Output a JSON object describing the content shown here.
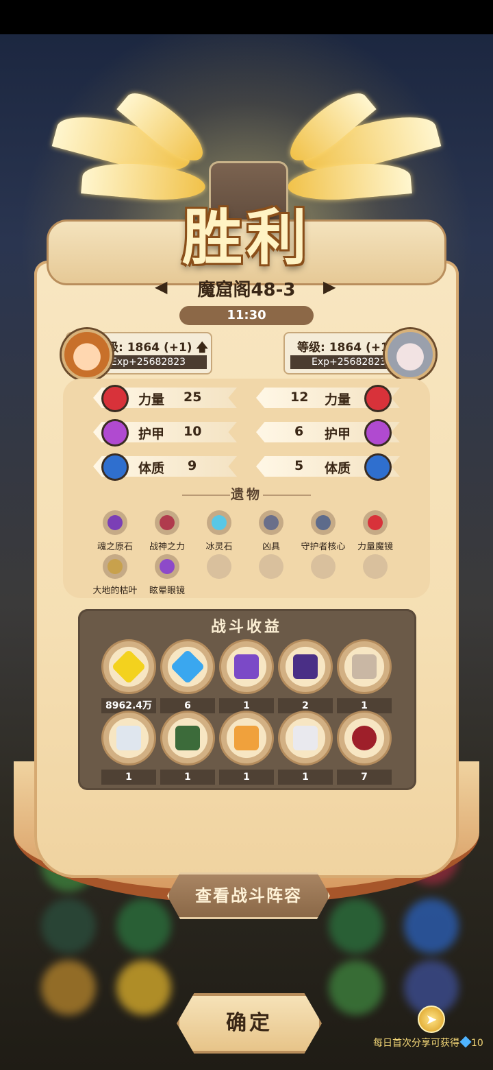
{
  "result": {
    "title": "胜利"
  },
  "stage": {
    "name": "魔窟阁48-3",
    "time": "11:30"
  },
  "players": {
    "left": {
      "level": "级: 1864 (+1)",
      "exp": "Exp+25682823"
    },
    "right": {
      "level": "等级: 1864 (+1)",
      "exp": "Exp+25682823"
    }
  },
  "stats": {
    "left": [
      {
        "label": "力量",
        "value": "25",
        "icon": "strength-icon",
        "color": "#d8323a"
      },
      {
        "label": "护甲",
        "value": "10",
        "icon": "armor-icon",
        "color": "#b04ad0"
      },
      {
        "label": "体质",
        "value": "9",
        "icon": "constitution-icon",
        "color": "#2f6fcf"
      }
    ],
    "right": [
      {
        "label": "力量",
        "value": "12",
        "icon": "strength-icon",
        "color": "#d8323a"
      },
      {
        "label": "护甲",
        "value": "6",
        "icon": "armor-icon",
        "color": "#b04ad0"
      },
      {
        "label": "体质",
        "value": "5",
        "icon": "constitution-icon",
        "color": "#2f6fcf"
      }
    ]
  },
  "relics": {
    "label": "遗物",
    "items": [
      {
        "name": "魂之原石",
        "color": "#7b3fb6"
      },
      {
        "name": "战神之力",
        "color": "#b03b4d"
      },
      {
        "name": "冰灵石",
        "color": "#58c7e6"
      },
      {
        "name": "凶具",
        "color": "#6a6f8a"
      },
      {
        "name": "守护者核心",
        "color": "#5d6b8b"
      },
      {
        "name": "力量魔镜",
        "color": "#d8323a"
      },
      {
        "name": "大地的枯叶",
        "color": "#c8a14c"
      },
      {
        "name": "眩晕眼镜",
        "color": "#8d4ac9"
      }
    ]
  },
  "earnings": {
    "title": "战斗收益",
    "items": [
      {
        "name": "gold-gem-icon",
        "count": "8962.4万",
        "color": "#f3d21e"
      },
      {
        "name": "blue-gem-icon",
        "count": "6",
        "color": "#3aa7ef"
      },
      {
        "name": "purple-monster-card-icon",
        "count": "1",
        "color": "#7b49c7"
      },
      {
        "name": "dark-monster-card-icon",
        "count": "2",
        "color": "#4a2f86"
      },
      {
        "name": "dog-card-icon",
        "count": "1",
        "color": "#c9b7a4"
      },
      {
        "name": "ghost-card-icon",
        "count": "1",
        "color": "#dfe6ee"
      },
      {
        "name": "green-robot-card-icon",
        "count": "1",
        "color": "#3c6b3a"
      },
      {
        "name": "bird-card-icon",
        "count": "1",
        "color": "#f0a13c"
      },
      {
        "name": "white-creature-card-icon",
        "count": "1",
        "color": "#e9e9ee"
      },
      {
        "name": "red-ore-icon",
        "count": "7",
        "color": "#9e1f2a"
      }
    ]
  },
  "buttons": {
    "lineup": "查看战斗阵容",
    "confirm": "确定"
  },
  "share": {
    "text": "每日首次分享可获得",
    "reward": "10"
  }
}
